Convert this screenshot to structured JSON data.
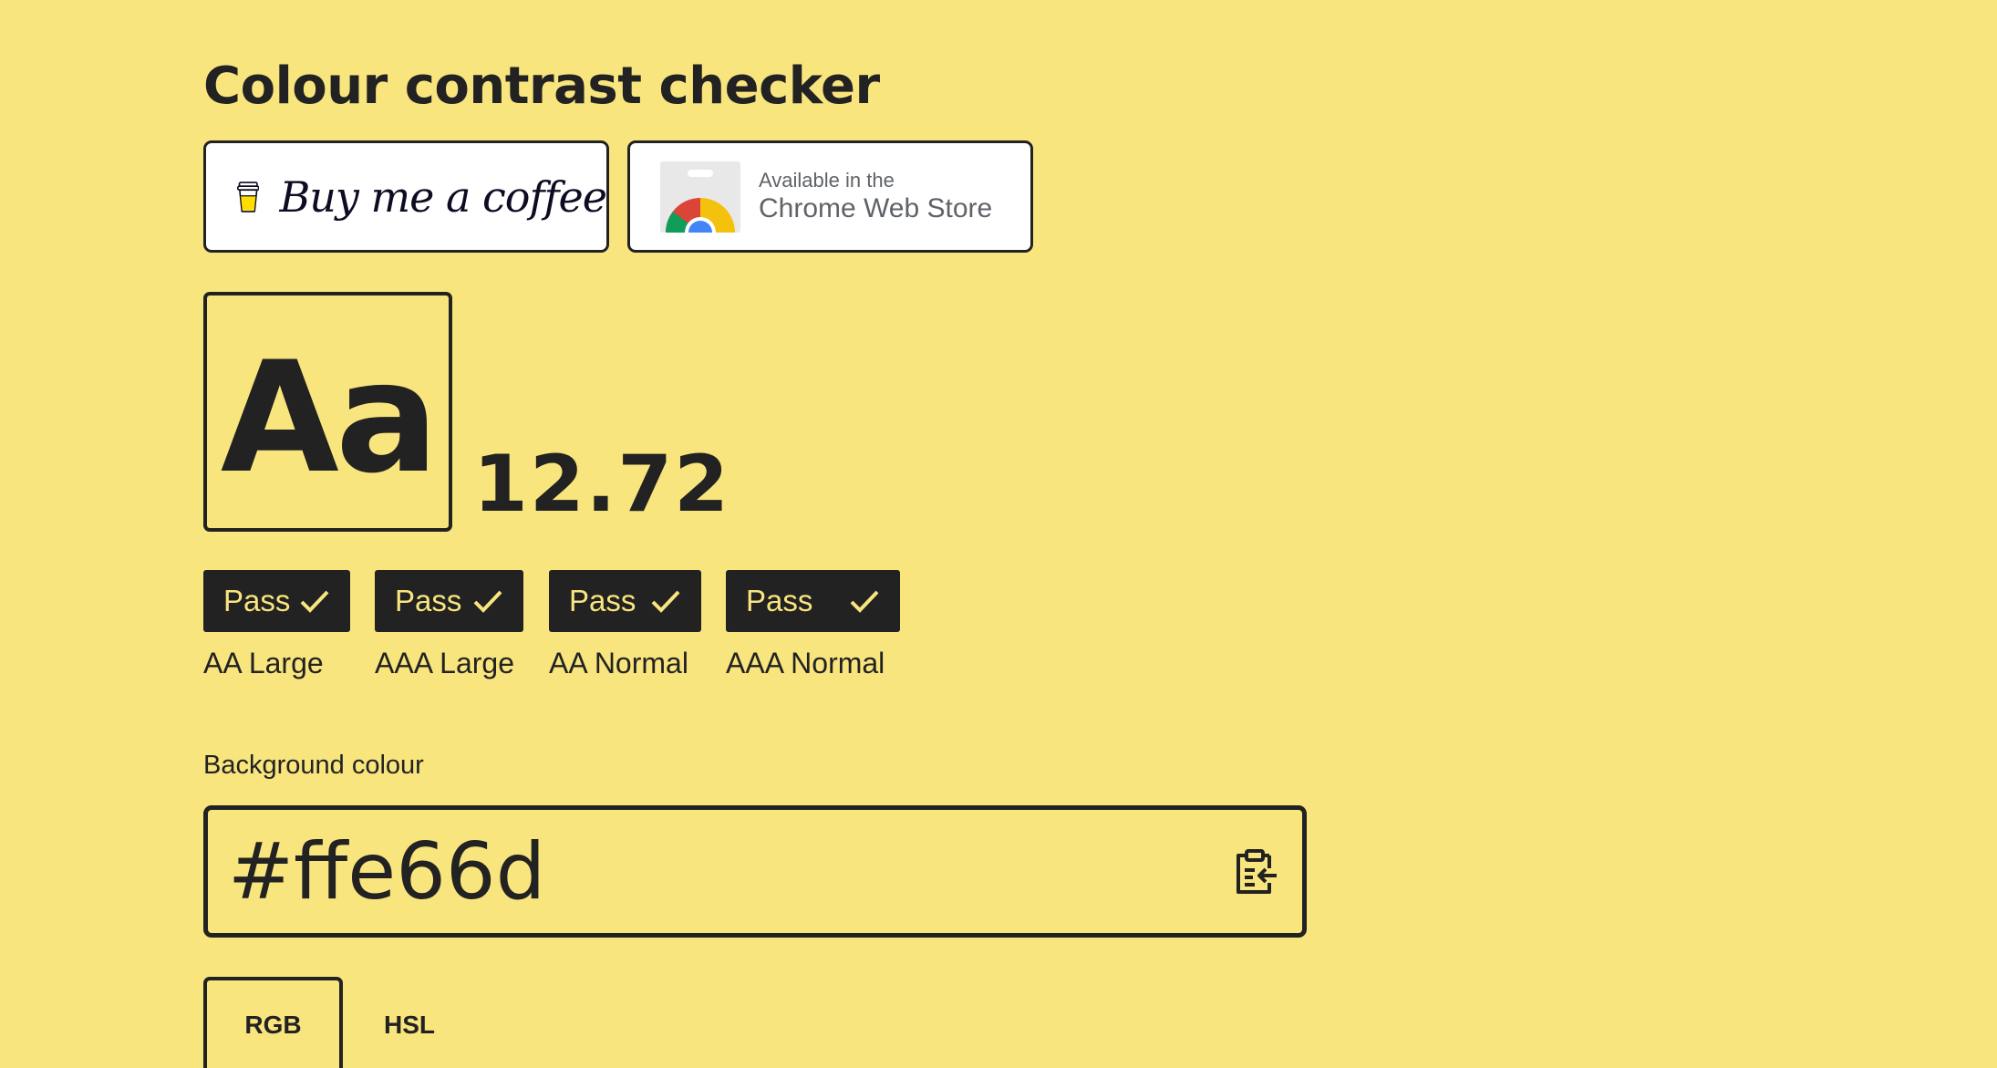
{
  "page": {
    "title": "Colour contrast checker",
    "background_colour": "#f9e57e",
    "text_colour": "#222222"
  },
  "promos": {
    "coffee": {
      "text": "Buy me a coffee",
      "icon": "coffee-cup-icon"
    },
    "chrome_store": {
      "line1": "Available in the",
      "line2": "Chrome Web Store",
      "icon": "chrome-logo-icon"
    }
  },
  "preview": {
    "sample_text": "Aa",
    "ratio": "12.72"
  },
  "results": [
    {
      "status": "Pass",
      "label": "AA Large",
      "icon": "check-icon"
    },
    {
      "status": "Pass",
      "label": "AAA Large",
      "icon": "check-icon"
    },
    {
      "status": "Pass",
      "label": "AA Normal",
      "icon": "check-icon"
    },
    {
      "status": "Pass",
      "label": "AAA Normal",
      "icon": "check-icon"
    }
  ],
  "background_field": {
    "label": "Background colour",
    "value": "#ffe66d",
    "paste_icon": "clipboard-paste-icon"
  },
  "tabs": [
    {
      "label": "RGB",
      "selected": true
    },
    {
      "label": "HSL",
      "selected": false
    }
  ]
}
